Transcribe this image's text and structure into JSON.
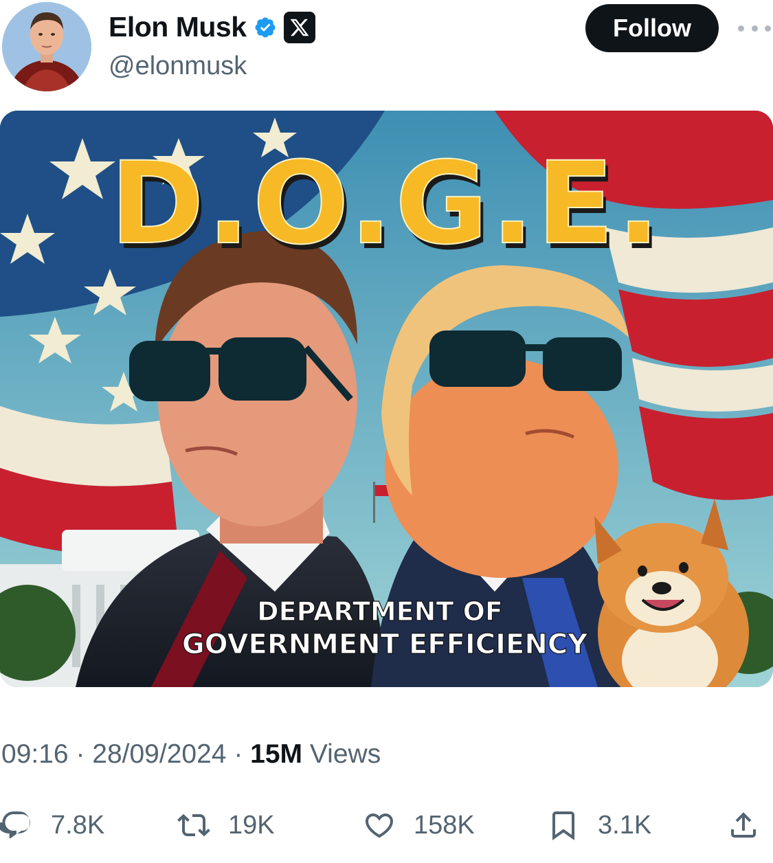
{
  "tweet": {
    "author": {
      "display_name": "Elon Musk",
      "handle": "@elonmusk",
      "avatar_icon": "profile-photo",
      "verified_icon": "verified-badge-icon",
      "affiliation_icon": "x-logo-icon"
    },
    "follow_label": "Follow",
    "more_icon": "more-horizontal-icon",
    "image": {
      "headline": "D.O.G.E.",
      "caption_line1": "DEPARTMENT OF",
      "caption_line2": "GOVERNMENT EFFICIENCY"
    },
    "timestamp": {
      "time": "09:16",
      "separator1": " · ",
      "date": "28/09/2024",
      "separator2": " · ",
      "views_count": "15M",
      "views_label": " Views"
    },
    "actions": {
      "replies": "7.8K",
      "reposts": "19K",
      "likes": "158K",
      "bookmarks": "3.1K"
    }
  },
  "colors": {
    "text_primary": "#0f1419",
    "text_secondary": "#536471",
    "verified_blue": "#1d9bf0",
    "doge_yellow": "#f7b926"
  }
}
